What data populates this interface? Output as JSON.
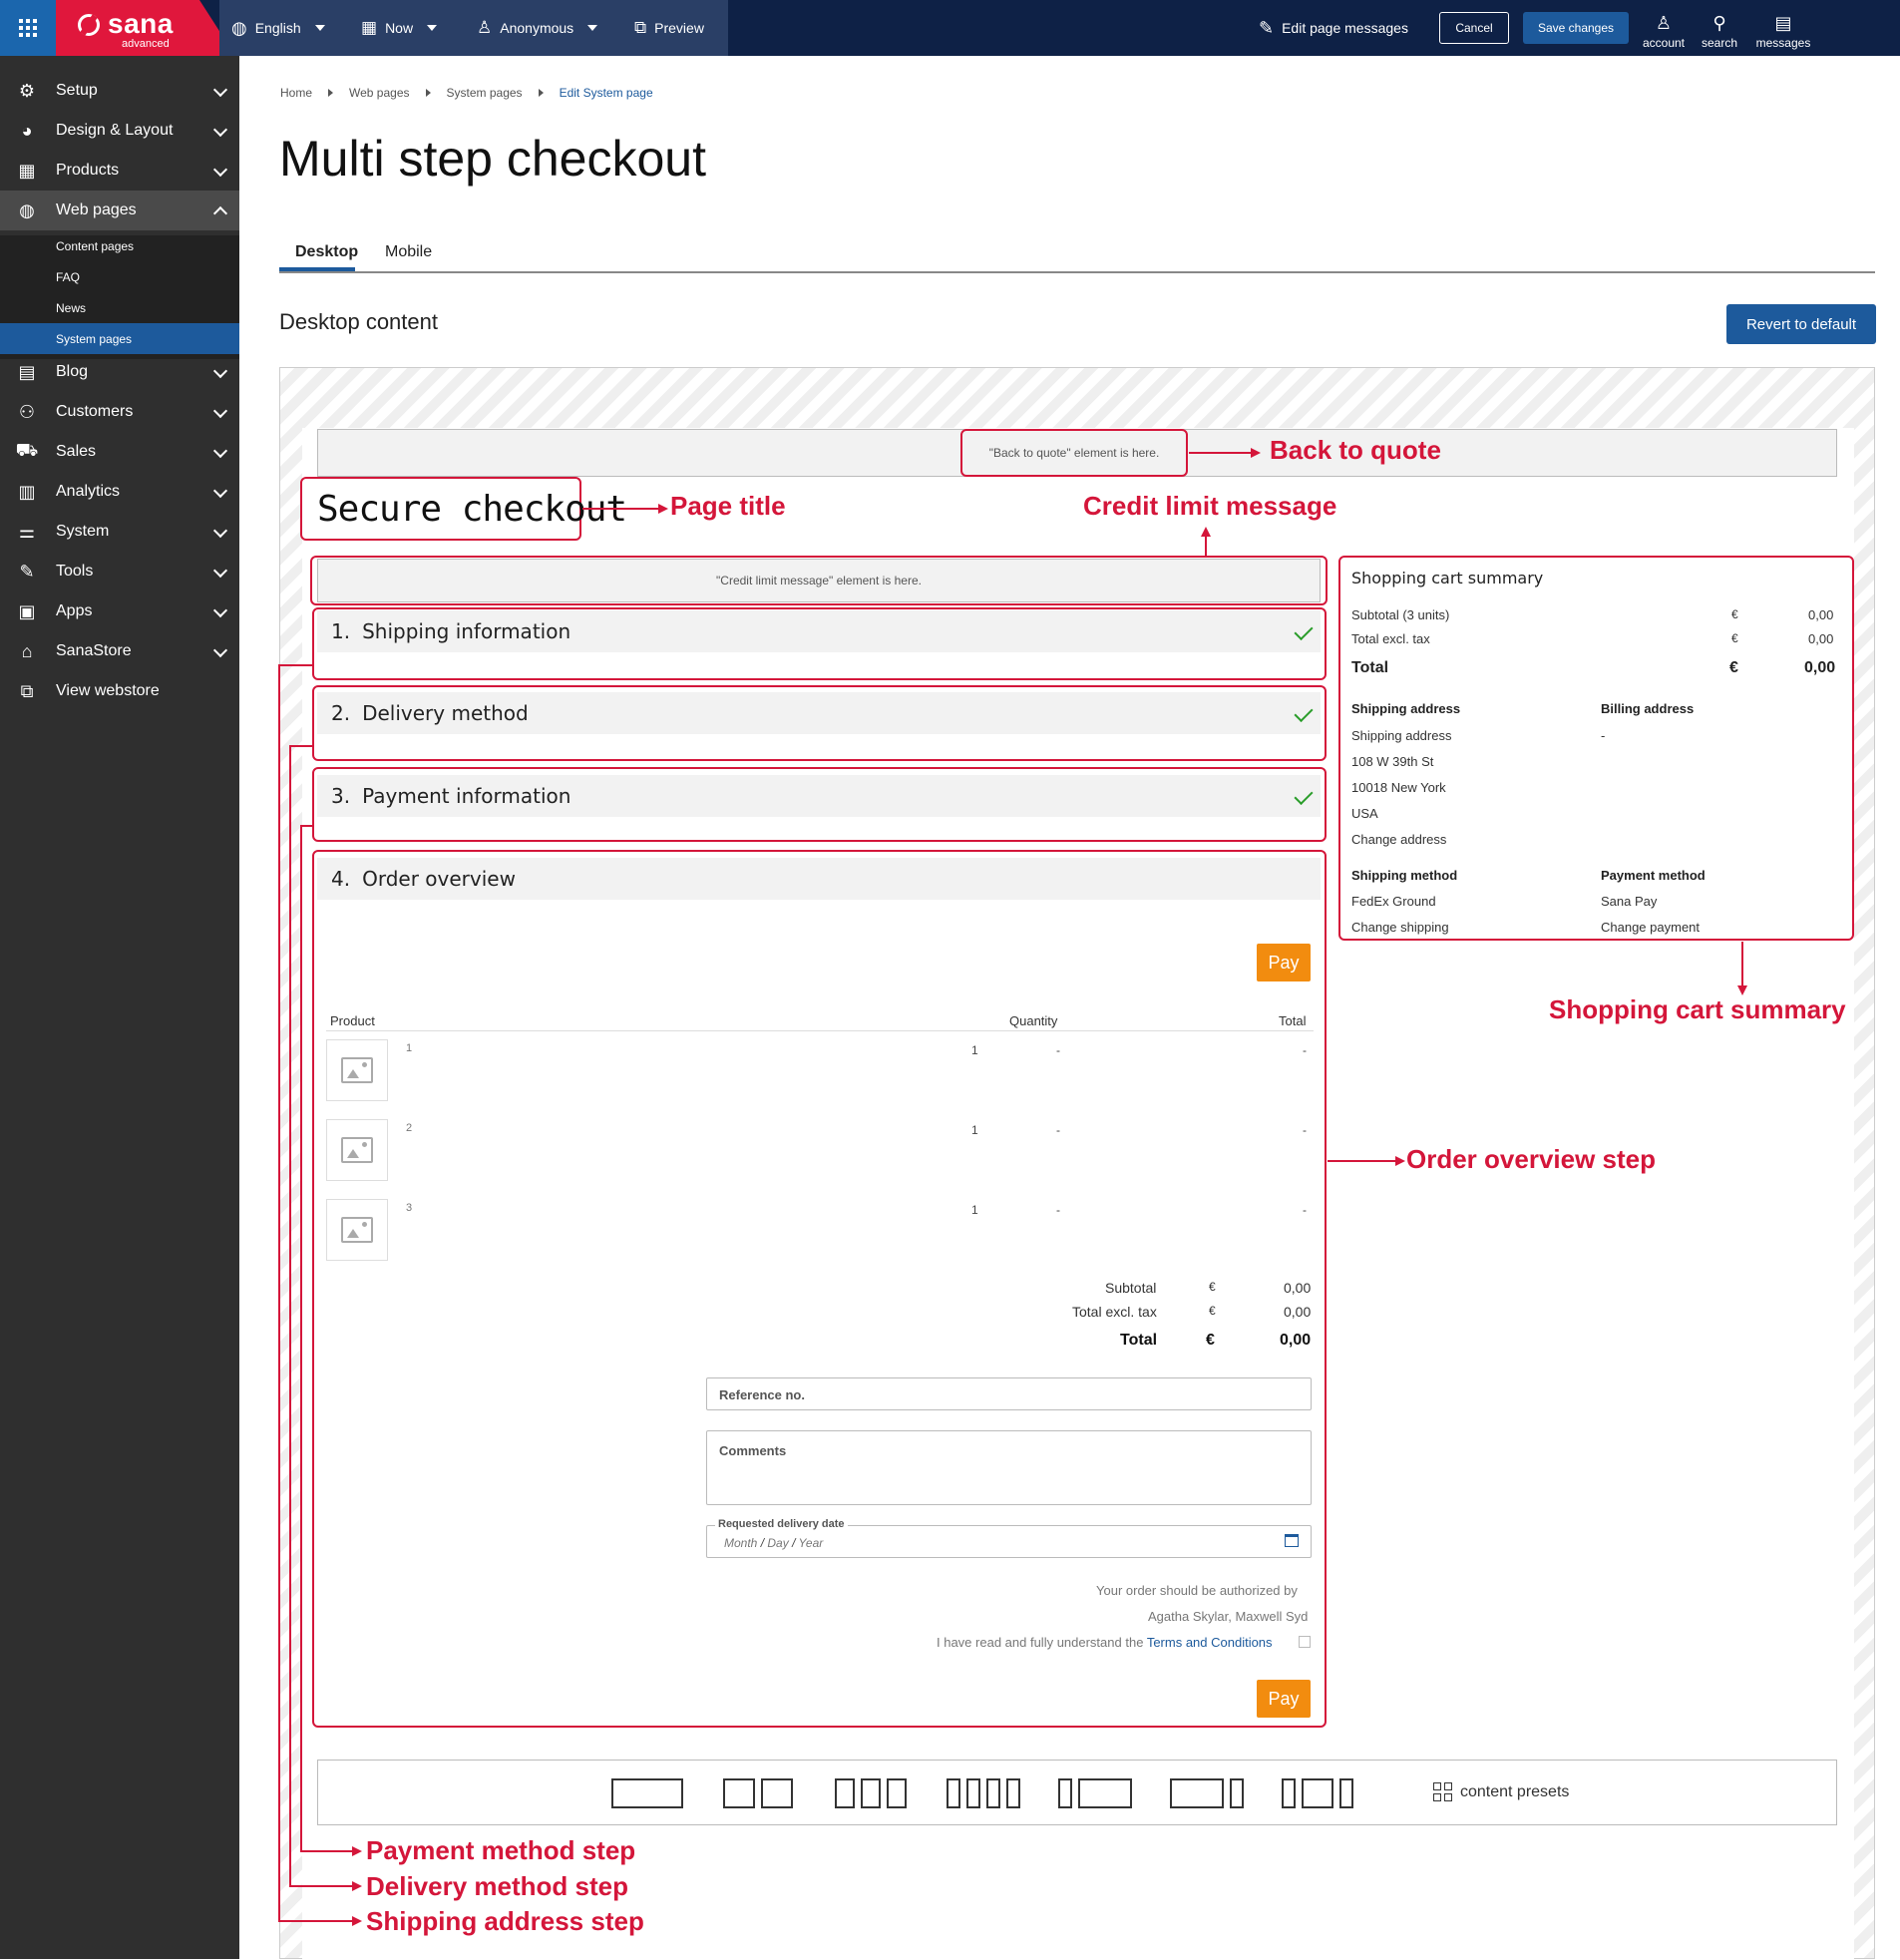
{
  "topbar": {
    "brand": "sana",
    "edition": "advanced",
    "language": "English",
    "date_mode": "Now",
    "visitor": "Anonymous",
    "preview": "Preview",
    "edit_messages": "Edit page messages",
    "cancel": "Cancel",
    "save": "Save changes",
    "account": "account",
    "search": "search",
    "messages": "messages"
  },
  "sidebar": {
    "items": [
      {
        "label": "Setup",
        "icon": "gear-icon"
      },
      {
        "label": "Design & Layout",
        "icon": "palette-icon"
      },
      {
        "label": "Products",
        "icon": "products-icon"
      },
      {
        "label": "Web pages",
        "icon": "globe-icon"
      },
      {
        "label": "Blog",
        "icon": "blog-icon"
      },
      {
        "label": "Customers",
        "icon": "customers-icon"
      },
      {
        "label": "Sales",
        "icon": "cart-icon"
      },
      {
        "label": "Analytics",
        "icon": "analytics-icon"
      },
      {
        "label": "System",
        "icon": "system-icon"
      },
      {
        "label": "Tools",
        "icon": "wrench-icon"
      },
      {
        "label": "Apps",
        "icon": "apps-icon"
      },
      {
        "label": "SanaStore",
        "icon": "store-icon"
      },
      {
        "label": "View webstore",
        "icon": "external-link-icon"
      }
    ],
    "sub_items": [
      "Content pages",
      "FAQ",
      "News",
      "System pages"
    ]
  },
  "breadcrumb": [
    "Home",
    "Web pages",
    "System pages",
    "Edit System page"
  ],
  "page_title": "Multi step checkout",
  "tabs": [
    "Desktop",
    "Mobile"
  ],
  "section_title": "Desktop content",
  "revert": "Revert to default",
  "canvas": {
    "back_to_quote": "\"Back to quote\" element is here.",
    "credit_limit": "\"Credit limit message\" element is here.",
    "checkout_title": "Secure checkout",
    "steps": [
      {
        "num": "1.",
        "label": "Shipping information"
      },
      {
        "num": "2.",
        "label": "Delivery method"
      },
      {
        "num": "3.",
        "label": "Payment information"
      },
      {
        "num": "4.",
        "label": "Order overview"
      }
    ],
    "pay": "Pay",
    "table_headers": {
      "product": "Product",
      "quantity": "Quantity",
      "total": "Total"
    },
    "rows": [
      {
        "index": "1",
        "qty": "1",
        "price": "-",
        "total": "-"
      },
      {
        "index": "2",
        "qty": "1",
        "price": "-",
        "total": "-"
      },
      {
        "index": "3",
        "qty": "1",
        "price": "-",
        "total": "-"
      }
    ],
    "totals": {
      "subtotal_label": "Subtotal",
      "subtotal_cur": "€",
      "subtotal": "0,00",
      "excl_label": "Total excl. tax",
      "excl_cur": "€",
      "excl": "0,00",
      "total_label": "Total",
      "total_cur": "€",
      "total": "0,00"
    },
    "reference_placeholder": "Reference no.",
    "comments_placeholder": "Comments",
    "delivery_date_label": "Requested delivery date",
    "date_month": "Month",
    "date_day": "Day",
    "date_year": "Year",
    "date_sep": "/",
    "authorized_by": "Your order should be authorized by",
    "authorizers": "Agatha Skylar, Maxwell Syd",
    "terms_prefix": "I have read and fully understand the ",
    "terms_link": "Terms and Conditions",
    "presets_label": "content presets"
  },
  "cart": {
    "title": "Shopping cart summary",
    "subtotal_label": "Subtotal (3 units)",
    "subtotal_cur": "€",
    "subtotal": "0,00",
    "excl_label": "Total excl. tax",
    "excl_cur": "€",
    "excl": "0,00",
    "total_label": "Total",
    "total_cur": "€",
    "total": "0,00",
    "shipping_address_title": "Shipping address",
    "shipping_address_lines": [
      "Shipping address",
      "108 W 39th St",
      "10018 New York",
      "USA"
    ],
    "change_address": "Change address",
    "billing_address_title": "Billing address",
    "billing_address": "-",
    "shipping_method_title": "Shipping method",
    "shipping_method": "FedEx Ground",
    "change_shipping": "Change shipping",
    "payment_method_title": "Payment method",
    "payment_method": "Sana Pay",
    "change_payment": "Change payment"
  },
  "annotations": {
    "back_to_quote": "Back to quote",
    "page_title": "Page title",
    "credit_limit": "Credit limit message",
    "cart_summary": "Shopping cart summary",
    "order_overview": "Order overview step",
    "payment_step": "Payment method step",
    "delivery_step": "Delivery method step",
    "shipping_step": "Shipping address step"
  }
}
